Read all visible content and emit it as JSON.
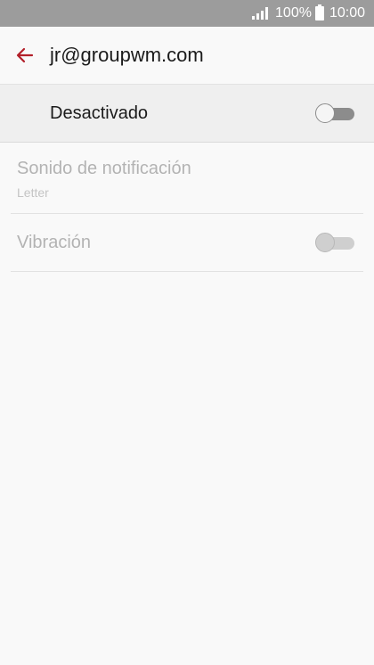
{
  "status_bar": {
    "battery_percent": "100%",
    "time": "10:00"
  },
  "app_bar": {
    "title": "jr@groupwm.com",
    "back_icon": "arrow-left-icon",
    "accent_color": "#b3202a"
  },
  "master_switch": {
    "label": "Desactivado",
    "state": "off"
  },
  "settings": {
    "notification_sound": {
      "title": "Sonido de notificación",
      "value": "Letter",
      "enabled": false
    },
    "vibration": {
      "title": "Vibración",
      "state": "off",
      "enabled": false
    }
  }
}
